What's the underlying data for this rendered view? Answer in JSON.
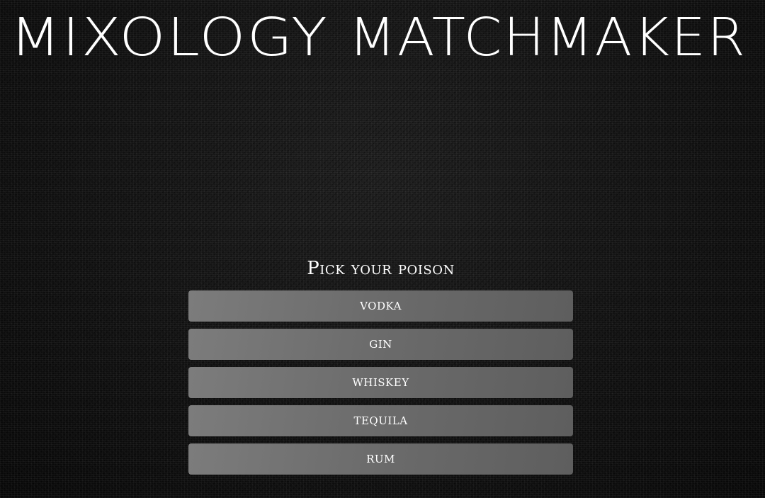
{
  "header": {
    "title_part1": "MIXOLOGY",
    "title_part2": "MATCHMAKER"
  },
  "quiz": {
    "prompt": "Pick your poison",
    "options": [
      {
        "label": "VODKA"
      },
      {
        "label": "GIN"
      },
      {
        "label": "WHISKEY"
      },
      {
        "label": "TEQUILA"
      },
      {
        "label": "RUM"
      }
    ]
  },
  "colors": {
    "background": "#0b0b0b",
    "text": "#ffffff",
    "button_start": "#7c7c7c",
    "button_end": "#5e5e5e"
  }
}
